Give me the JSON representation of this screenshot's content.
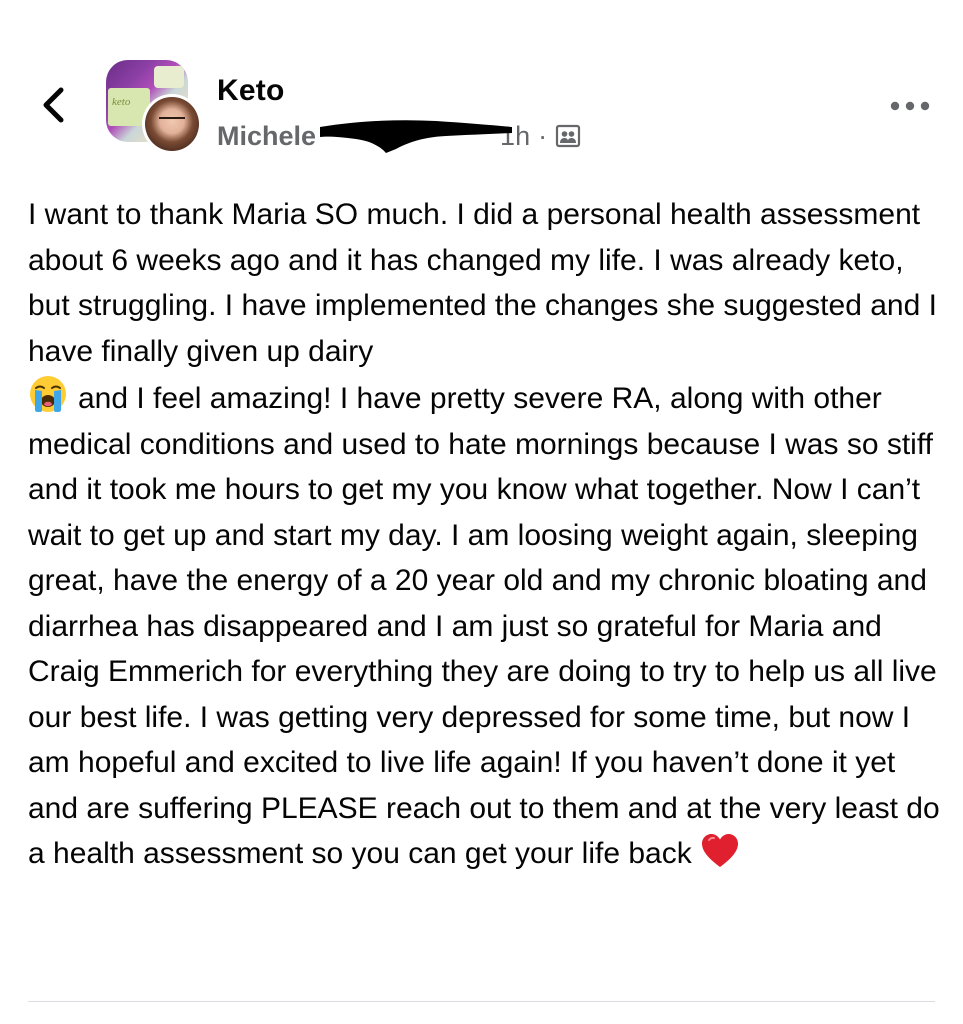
{
  "header": {
    "group_name": "Keto",
    "author_name": "Michele",
    "timestamp": "1h",
    "separator": "·",
    "group_thumb_label": "keto",
    "icons": {
      "back": "chevron-left-icon",
      "audience": "group-members-icon",
      "more": "more-options-icon"
    }
  },
  "post": {
    "text_part1": "I want to thank Maria SO much. I did a personal health assessment about 6 weeks ago and it has changed my life. I was already keto, but struggling. I have implemented the changes she suggested and I have finally given up dairy",
    "text_part2": "and I feel amazing! I have pretty severe RA, along with other medical conditions and used to hate mornings because I was so stiff and it took me hours to get my you know what together. Now I can’t wait to get up and start my day. I am loosing weight again, sleeping great, have the energy of a 20 year old and my chronic bloating and diarrhea has disappeared and I am just so grateful for Maria and Craig Emmerich for everything they are doing to try to help us all live our best life. I was getting very depressed for some time, but now I am hopeful and excited to live life again! If you haven’t done it yet and are suffering PLEASE reach out to them and at the very least do a health assessment so you can get your life back",
    "emojis": {
      "crying": "loudly-crying-face-emoji",
      "heart": "red-heart-emoji"
    }
  },
  "colors": {
    "text": "#050505",
    "secondary_text": "#65676b",
    "divider": "#dadde1",
    "heart": "#e0202e",
    "emoji_face": "#ffcc33"
  }
}
